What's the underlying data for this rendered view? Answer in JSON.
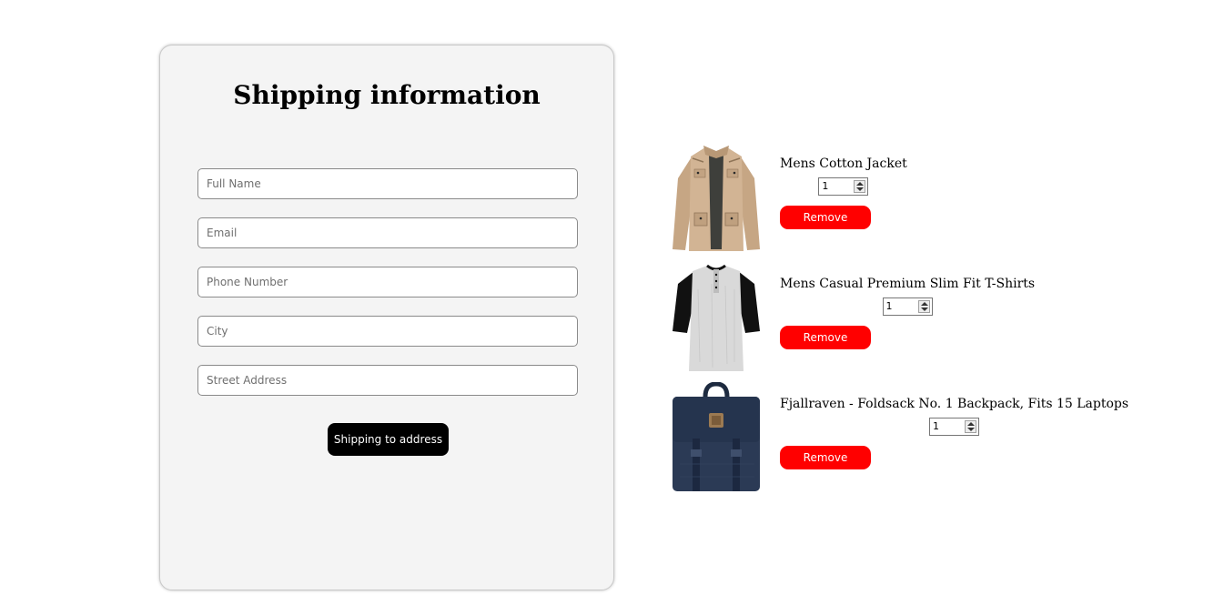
{
  "shipping_form": {
    "title": "Shipping information",
    "fields": [
      {
        "placeholder": "Full Name",
        "value": ""
      },
      {
        "placeholder": "Email",
        "value": ""
      },
      {
        "placeholder": "Phone Number",
        "value": ""
      },
      {
        "placeholder": "City",
        "value": ""
      },
      {
        "placeholder": "Street Address",
        "value": ""
      }
    ],
    "submit_label": "Shipping to address"
  },
  "cart": {
    "items": [
      {
        "title": "Mens Cotton Jacket",
        "quantity": "1",
        "remove_label": "Remove",
        "image": "jacket-image"
      },
      {
        "title": "Mens Casual Premium Slim Fit T-Shirts",
        "quantity": "1",
        "remove_label": "Remove",
        "image": "tshirt-image"
      },
      {
        "title": "Fjallraven - Foldsack No. 1 Backpack, Fits 15 Laptops",
        "quantity": "1",
        "remove_label": "Remove",
        "image": "backpack-image"
      }
    ]
  },
  "colors": {
    "remove_button": "#ff0000",
    "submit_button": "#000000",
    "card_background": "#f4f4f4"
  }
}
